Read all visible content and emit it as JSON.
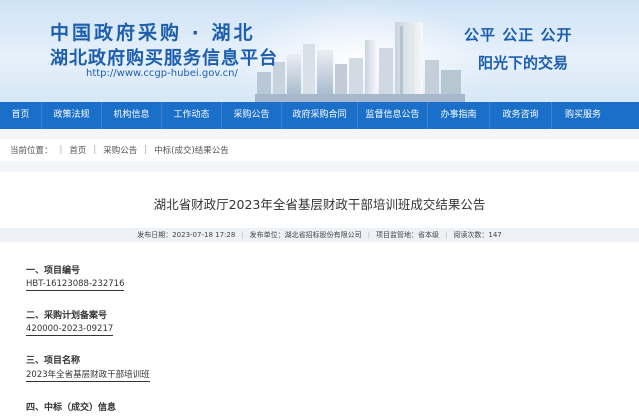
{
  "header": {
    "title_line1": "中国政府采购 · 湖北",
    "title_line2": "湖北政府购买服务信息平台",
    "url": "http://www.ccgp-hubei.gov.cn/",
    "slogan_line1": "公平 公正 公开",
    "slogan_line2": "阳光下的交易"
  },
  "nav": {
    "items": [
      {
        "label": "首页"
      },
      {
        "label": "政策法规"
      },
      {
        "label": "机构信息"
      },
      {
        "label": "工作动态"
      },
      {
        "label": "采购公告"
      },
      {
        "label": "政府采购合同"
      },
      {
        "label": "监督信息公告"
      },
      {
        "label": "办事指南"
      },
      {
        "label": "政务咨询"
      },
      {
        "label": "购买服务"
      }
    ]
  },
  "breadcrumb": {
    "prefix": "当前位置：",
    "items": [
      "首页",
      "采购公告",
      "中标(成交)结果公告"
    ]
  },
  "article": {
    "title": "湖北省财政厅2023年全省基层财政干部培训班成交结果公告",
    "meta": {
      "publish_time": "发布日期：2023-07-18 17:28",
      "publisher": "发布单位：湖北省招标股份有限公司",
      "supervisor": "项目监管地：省本级",
      "views": "阅读次数：147"
    },
    "sections": [
      {
        "heading": "一、项目编号",
        "value": "HBT-16123088-232716"
      },
      {
        "heading": "二、采购计划备案号",
        "value": "420000-2023-09217"
      },
      {
        "heading": "三、项目名称",
        "value": "2023年全省基层财政干部培训班"
      },
      {
        "heading": "四、中标（成交）信息",
        "value": ""
      }
    ]
  },
  "colors": {
    "nav_bg": "#1a6fc9",
    "brand_text": "#1d5fae",
    "page_bg": "#f3f5f8"
  }
}
